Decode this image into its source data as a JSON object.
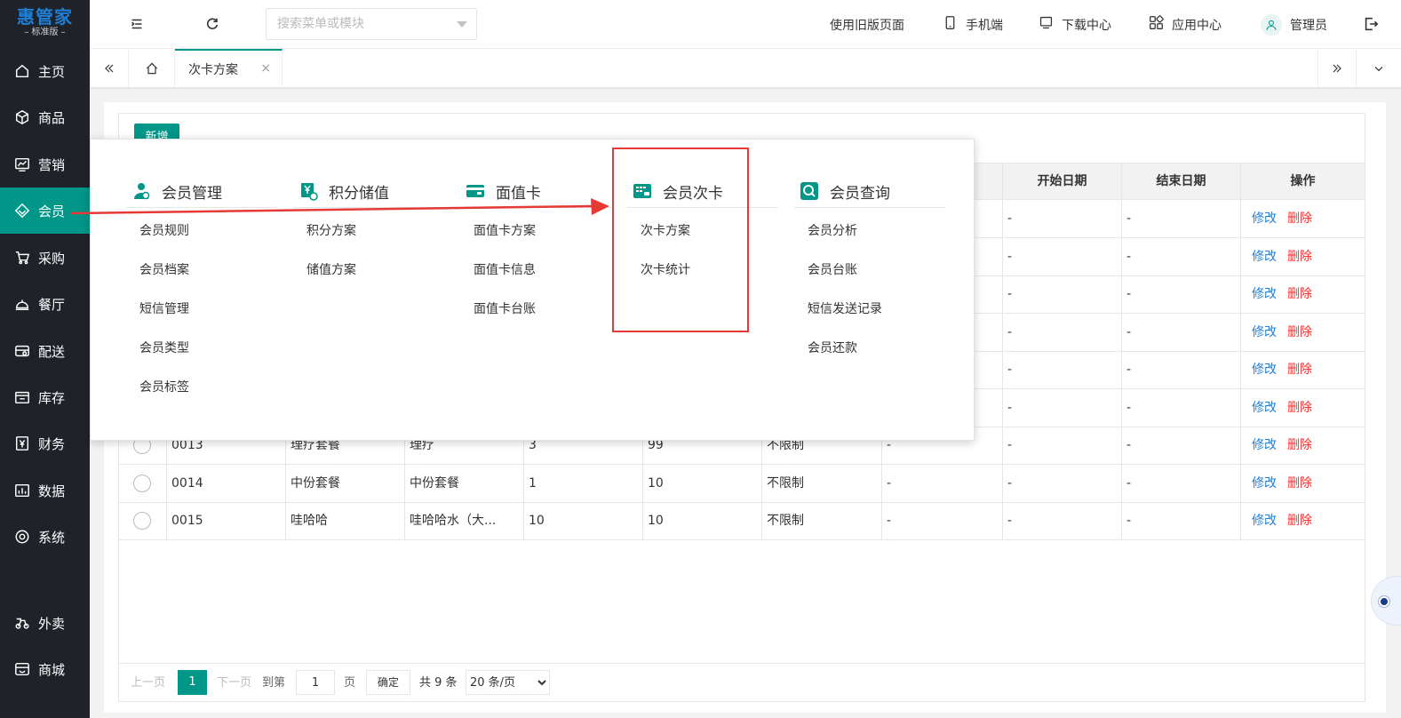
{
  "brand": {
    "name": "惠管家",
    "edition": "标准版"
  },
  "sidebar": {
    "items": [
      {
        "label": "主页",
        "icon": "home-icon"
      },
      {
        "label": "商品",
        "icon": "box-icon"
      },
      {
        "label": "营销",
        "icon": "trend-icon"
      },
      {
        "label": "会员",
        "icon": "diamond-icon",
        "active": true
      },
      {
        "label": "采购",
        "icon": "cart-icon"
      },
      {
        "label": "餐厅",
        "icon": "cloche-icon"
      },
      {
        "label": "配送",
        "icon": "truck-icon"
      },
      {
        "label": "库存",
        "icon": "warehouse-icon"
      },
      {
        "label": "财务",
        "icon": "yen-icon"
      },
      {
        "label": "数据",
        "icon": "chart-icon"
      },
      {
        "label": "系统",
        "icon": "settings-icon"
      },
      {
        "label": "外卖",
        "icon": "scooter-icon"
      },
      {
        "label": "商城",
        "icon": "store-icon"
      }
    ]
  },
  "header": {
    "search_placeholder": "搜索菜单或模块",
    "old_version": "使用旧版页面",
    "mobile": "手机端",
    "download": "下载中心",
    "apps": "应用中心",
    "user": "管理员"
  },
  "tabs": {
    "active_label": "次卡方案",
    "close_glyph": "×"
  },
  "toolbar": {
    "add_label": "新增"
  },
  "table": {
    "visible_headers": {
      "start_date": "开始日期",
      "end_date": "结束日期",
      "ops": "操作"
    },
    "edit_label": "修改",
    "delete_label": "删除",
    "partial_rows": [
      "-",
      "-",
      "-",
      "-",
      "-",
      "-"
    ],
    "rows": [
      {
        "code": "0013",
        "name": "理疗套餐",
        "item": "理疗",
        "qty": "3",
        "price": "99",
        "limit": "不限制",
        "c7": "-",
        "start": "-",
        "end": "-"
      },
      {
        "code": "0014",
        "name": "中份套餐",
        "item": "中份套餐",
        "qty": "1",
        "price": "10",
        "limit": "不限制",
        "c7": "-",
        "start": "-",
        "end": "-"
      },
      {
        "code": "0015",
        "name": "哇哈哈",
        "item": "哇哈哈水（大...",
        "qty": "10",
        "price": "10",
        "limit": "不限制",
        "c7": "-",
        "start": "-",
        "end": "-"
      }
    ]
  },
  "pager": {
    "prev": "上一页",
    "current": "1",
    "next": "下一页",
    "goto": "到第",
    "page_value": "1",
    "page_unit": "页",
    "confirm": "确定",
    "total": "共 9 条",
    "page_size": "20 条/页"
  },
  "menu": {
    "columns": [
      {
        "title": "会员管理",
        "icon": "member-manage-icon",
        "links": [
          "会员规则",
          "会员档案",
          "短信管理",
          "会员类型",
          "会员标签"
        ]
      },
      {
        "title": "积分储值",
        "icon": "points-icon",
        "links": [
          "积分方案",
          "储值方案"
        ]
      },
      {
        "title": "面值卡",
        "icon": "card-icon",
        "links": [
          "面值卡方案",
          "面值卡信息",
          "面值卡台账"
        ]
      },
      {
        "title": "会员次卡",
        "icon": "vip-card-icon",
        "links": [
          "次卡方案",
          "次卡统计"
        ]
      },
      {
        "title": "会员查询",
        "icon": "search-icon",
        "links": [
          "会员分析",
          "会员台账",
          "短信发送记录",
          "会员还款"
        ]
      }
    ]
  },
  "colors": {
    "accent": "#009688",
    "sidebar_bg": "#20222a",
    "link_blue": "#1e7fd8",
    "danger_red": "#ff2e2e",
    "annotation_red": "#e53935"
  }
}
